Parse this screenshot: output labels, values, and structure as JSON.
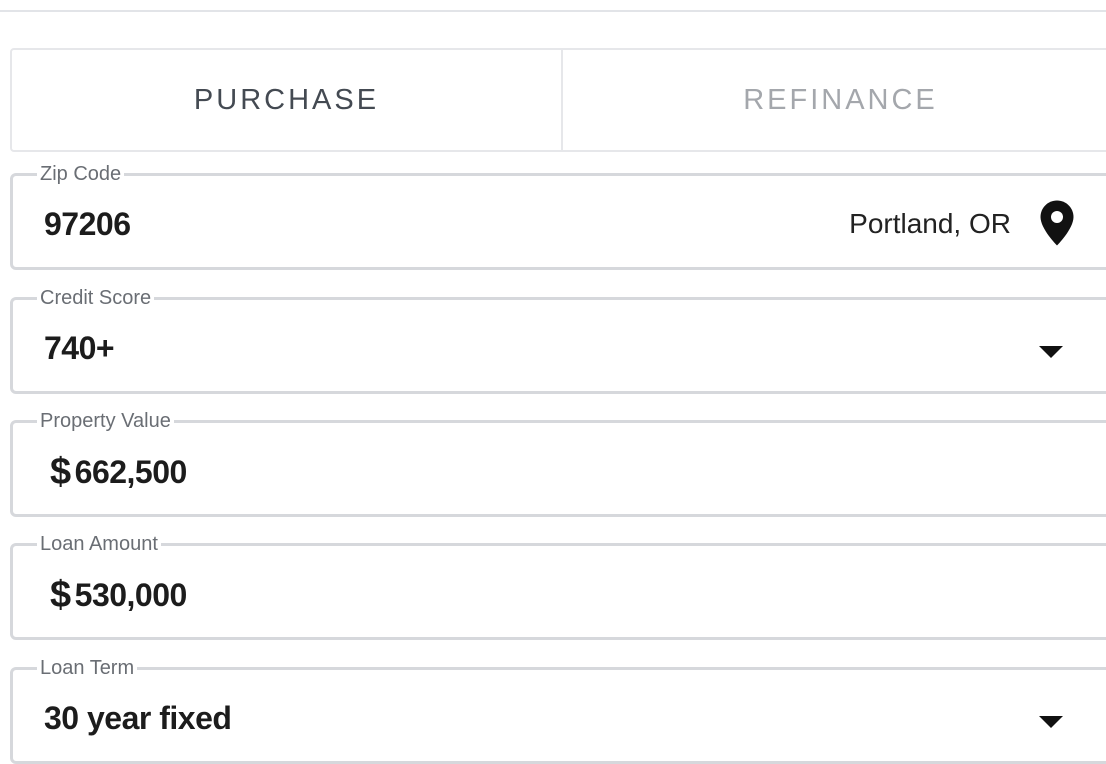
{
  "tabs": [
    {
      "label": "PURCHASE",
      "active": true
    },
    {
      "label": "REFINANCE",
      "active": false
    }
  ],
  "zip": {
    "label": "Zip Code",
    "value": "97206",
    "city": "Portland, OR"
  },
  "credit": {
    "label": "Credit Score",
    "value": "740+"
  },
  "property": {
    "label": "Property Value",
    "currency": "$",
    "value": "662,500"
  },
  "loan": {
    "label": "Loan Amount",
    "currency": "$",
    "value": "530,000"
  },
  "term": {
    "label": "Loan Term",
    "value": "30 year fixed"
  },
  "icons": {
    "location": "map-pin-icon",
    "dropdown": "caret-down-icon"
  },
  "colors": {
    "border": "#d6d8dc",
    "active_tab": "#444a52",
    "inactive_tab": "#a4a7ac"
  }
}
